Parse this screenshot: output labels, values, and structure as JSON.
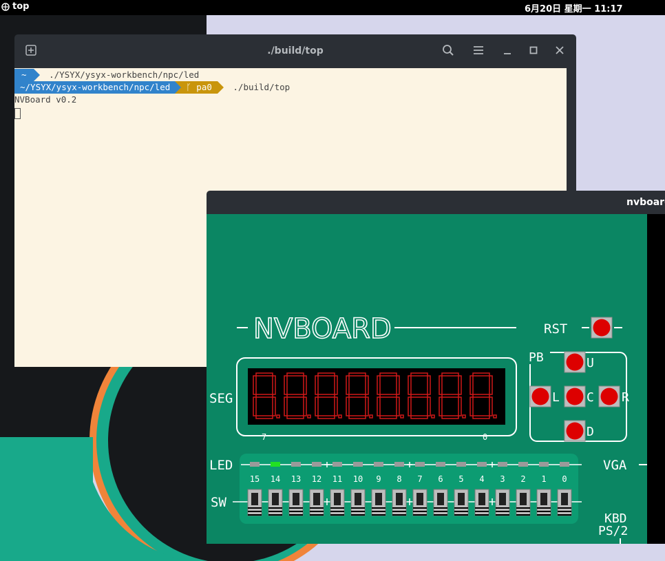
{
  "topbar": {
    "app_name": "top",
    "clock": "6月20日 星期一 11:17"
  },
  "terminal": {
    "title": "./build/top",
    "icons": [
      "new-tab-icon",
      "search-icon",
      "menu-icon",
      "minimize-icon",
      "maximize-icon",
      "close-icon"
    ],
    "lines": {
      "l1_badge": "~",
      "l1_path": "./YSYX/ysyx-workbench/npc/led",
      "l2_dir": "~/YSYX/ysyx-workbench/npc/led",
      "l2_branch_glyph": "ᚴ",
      "l2_branch": "pa0",
      "l2_cmd": "./build/top",
      "l3_output": "NVBoard v0.2"
    }
  },
  "nvboard": {
    "window_title": "nvboard",
    "logo": "NVBOARD",
    "rst_label": "RST",
    "pb_label": "PB",
    "btn_labels": {
      "up": "U",
      "left": "L",
      "center": "C",
      "right": "R",
      "down": "D"
    },
    "seg_label": "SEG",
    "seg_index_left": "7",
    "seg_index_right": "0",
    "digits": 8,
    "led_label": "LED",
    "sw_label": "SW",
    "vga_label": "VGA",
    "kbd_label": "KBD",
    "ps2_label": "PS/2",
    "bit_labels": [
      "15",
      "14",
      "13",
      "12",
      "11",
      "10",
      "9",
      "8",
      "7",
      "6",
      "5",
      "4",
      "3",
      "2",
      "1",
      "0"
    ],
    "led_states": [
      0,
      1,
      0,
      0,
      0,
      0,
      0,
      0,
      0,
      0,
      0,
      0,
      0,
      0,
      0,
      0
    ],
    "colors": {
      "board": "#0b8663",
      "seg_red": "#d01818",
      "led_on": "#22e022",
      "led_off": "#9a9a9a",
      "button_red": "#dd0000"
    }
  }
}
